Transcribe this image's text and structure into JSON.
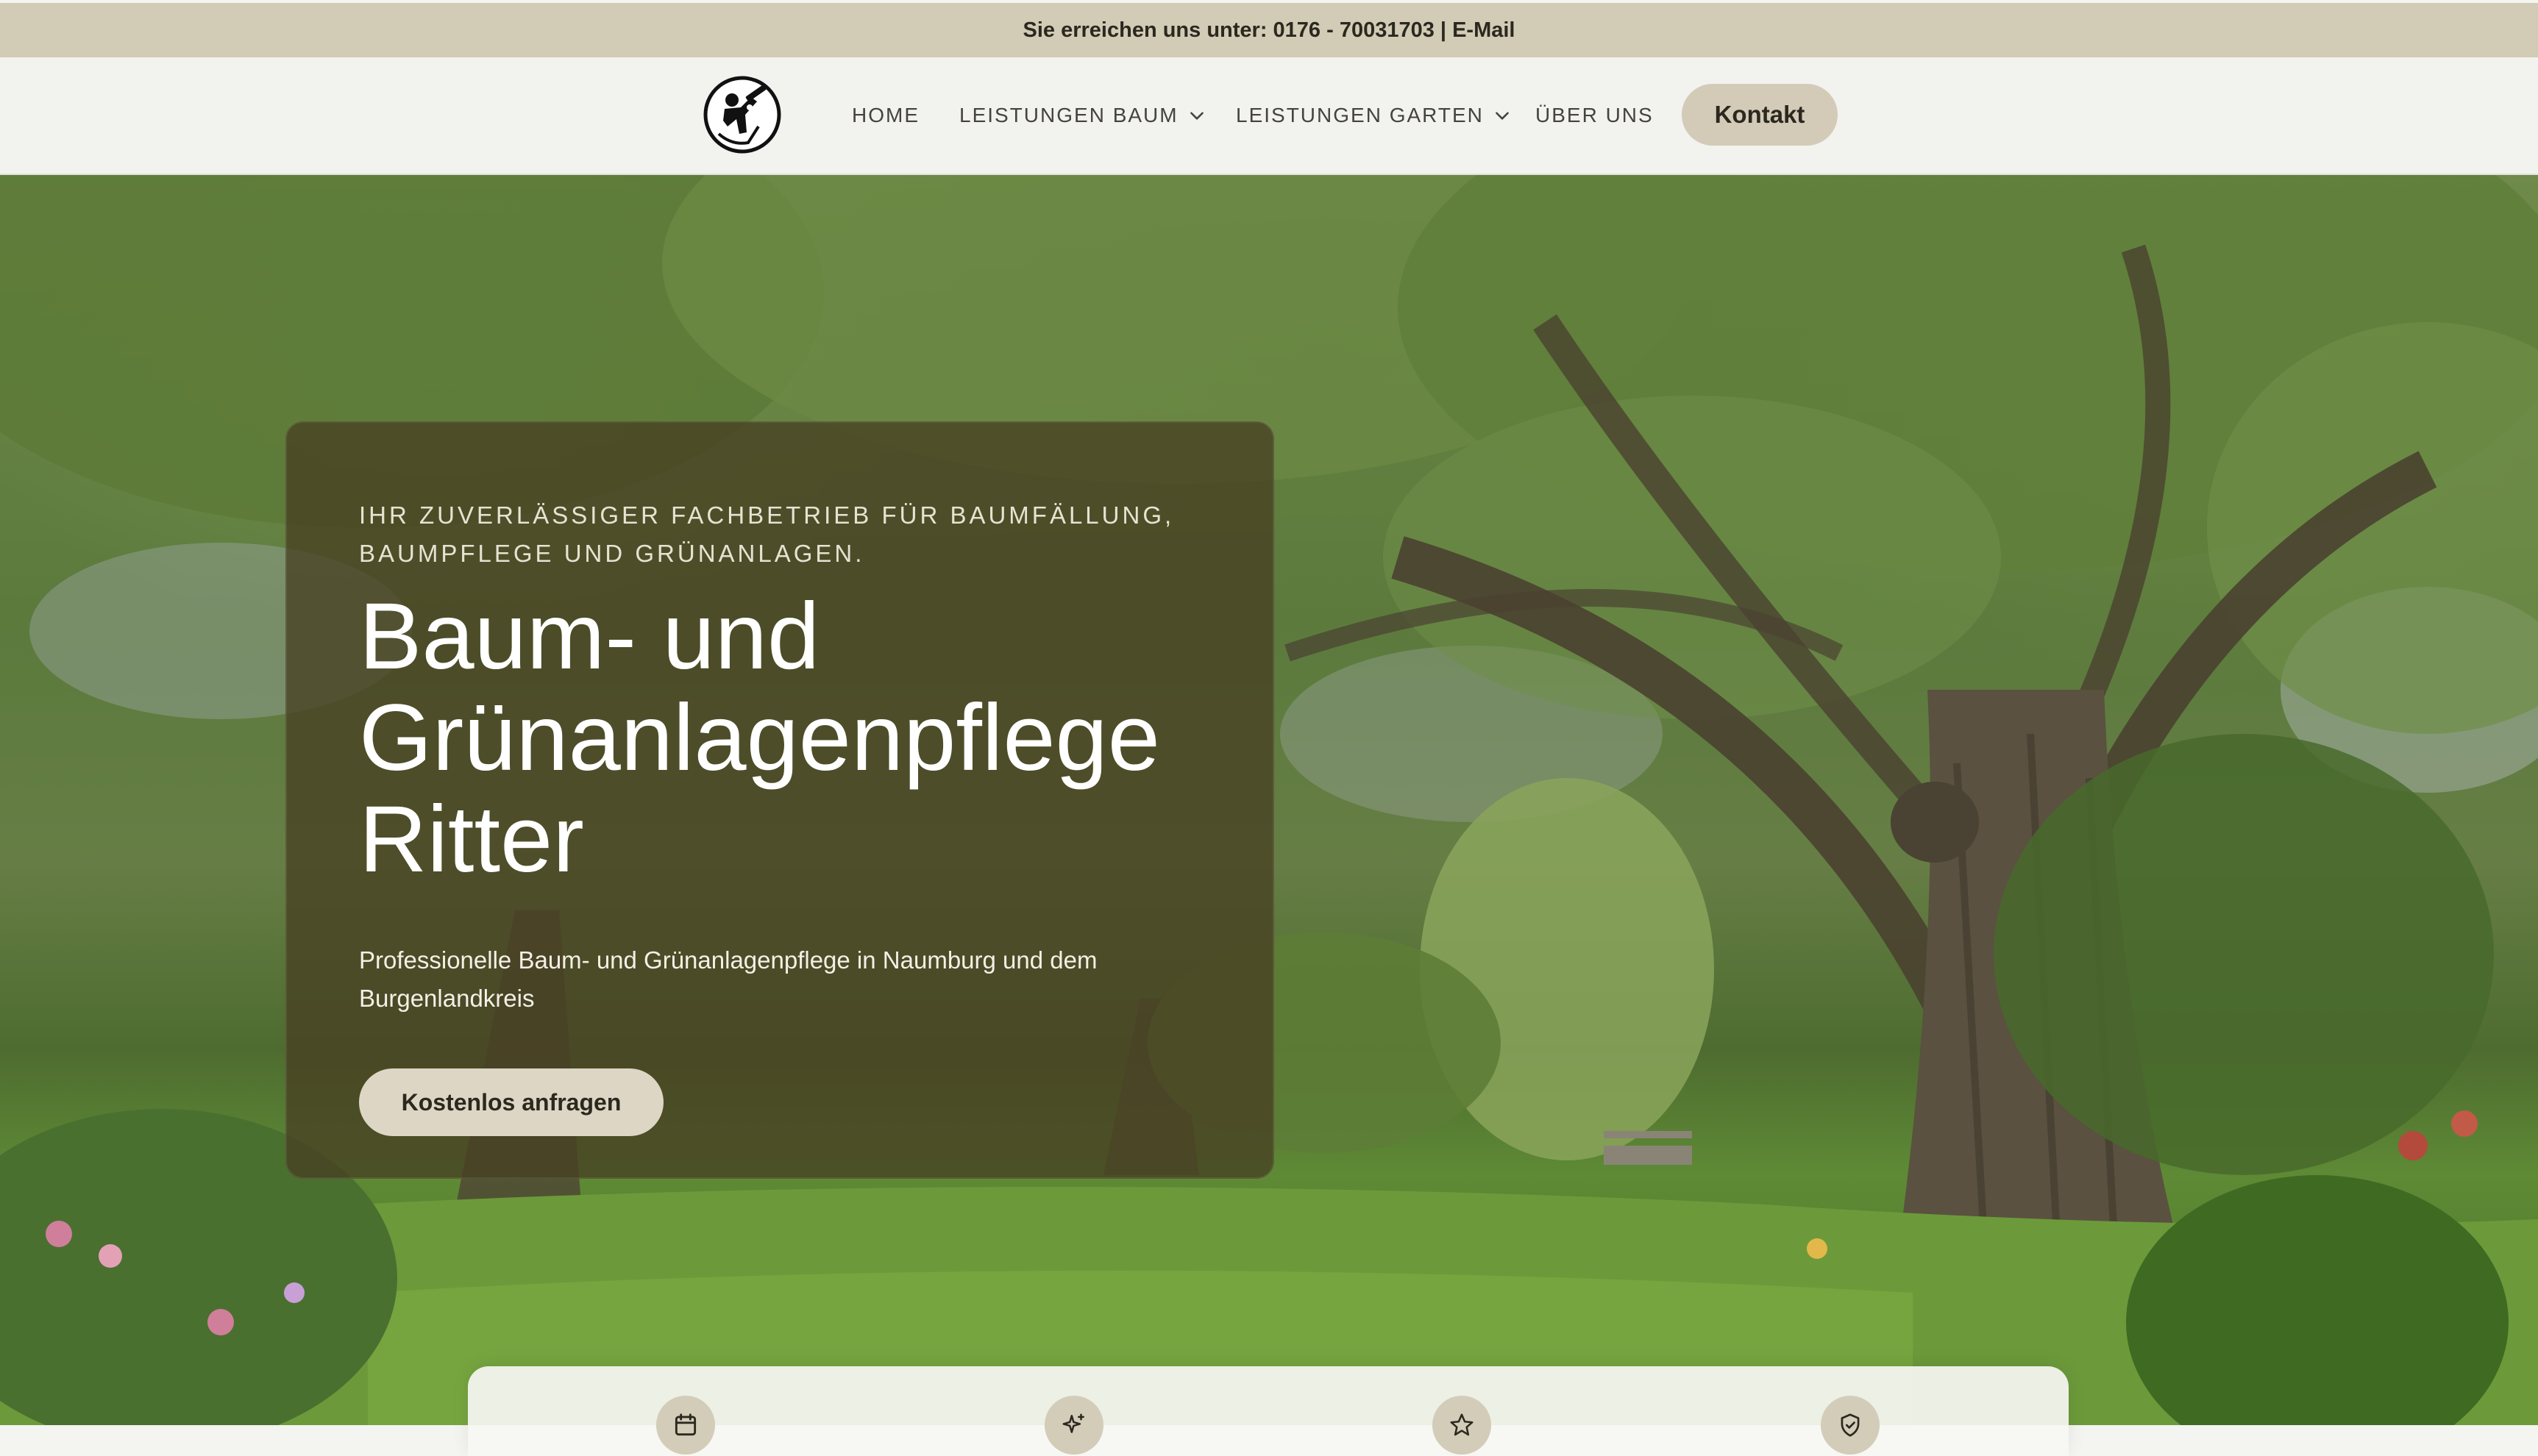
{
  "topbar": {
    "prefix": "Sie erreichen uns unter: ",
    "phone": "0176 - 70031703",
    "separator": " | ",
    "email_label": "E-Mail"
  },
  "nav": {
    "logo_icon": "arborist-logo-icon",
    "items": [
      {
        "label": "HOME",
        "dropdown": false
      },
      {
        "label": "LEISTUNGEN BAUM",
        "dropdown": true
      },
      {
        "label": "LEISTUNGEN GARTEN",
        "dropdown": true
      },
      {
        "label": "ÜBER UNS",
        "dropdown": false
      }
    ],
    "cta_label": "Kontakt"
  },
  "hero": {
    "eyebrow": "IHR ZUVERLÄSSIGER FACHBETRIEB FÜR BAUMFÄLLUNG, BAUMPFLEGE UND GRÜNANLAGEN.",
    "title_line1": "Baum- und",
    "title_line2": "Grünanlagenpflege",
    "title_line3": "Ritter",
    "subtitle": "Professionelle Baum- und Grünanlagenpflege in Naumburg und dem Burgenlandkreis",
    "cta_label": "Kostenlos anfragen"
  },
  "features": {
    "icons": [
      "calendar-icon",
      "sparkles-icon",
      "star-icon",
      "shield-check-icon"
    ]
  },
  "colors": {
    "topbar_bg": "#d2cbb5",
    "button_bg": "#d3cbb8",
    "card_bg": "#484022",
    "nav_bg": "#f2f2ef"
  }
}
